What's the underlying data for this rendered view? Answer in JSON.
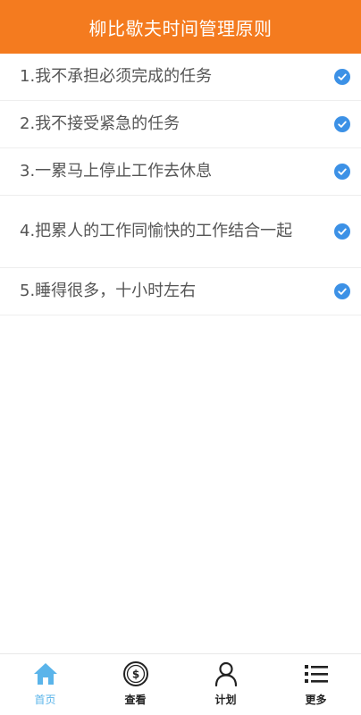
{
  "header": {
    "title": "柳比歇夫时间管理原则"
  },
  "colors": {
    "header_bg": "#f47b1f",
    "check": "#3c91e6",
    "active_tab": "#5ab4ea",
    "text": "#555555"
  },
  "principles": [
    {
      "text": "1.我不承担必须完成的任务",
      "checked": true
    },
    {
      "text": "2.我不接受紧急的任务",
      "checked": true
    },
    {
      "text": "3.一累马上停止工作去休息",
      "checked": true
    },
    {
      "text": "4.把累人的工作同愉快的工作结合一起",
      "checked": true
    },
    {
      "text": "5.睡得很多，十小时左右",
      "checked": true
    }
  ],
  "tabbar": {
    "tabs": [
      {
        "label": "首页",
        "icon": "home-icon",
        "active": true
      },
      {
        "label": "查看",
        "icon": "dollar-coin-icon",
        "active": false
      },
      {
        "label": "计划",
        "icon": "person-icon",
        "active": false
      },
      {
        "label": "更多",
        "icon": "list-icon",
        "active": false
      }
    ]
  }
}
